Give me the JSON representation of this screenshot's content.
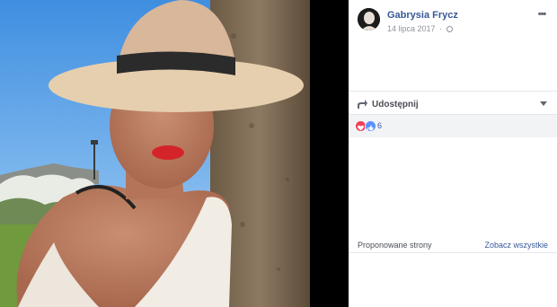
{
  "post": {
    "author": "Gabrysia Frycz",
    "date": "14 lipca 2017",
    "separator": "·",
    "more_label": "•••"
  },
  "actions": {
    "share_label": "Udostępnij"
  },
  "reactions": {
    "count": "6"
  },
  "suggested": {
    "title": "Proponowane strony",
    "see_all": "Zobacz wszystkie"
  },
  "colors": {
    "link": "#365899",
    "love": "#f33e58",
    "like": "#5890ff"
  },
  "icons": [
    "globe-icon",
    "share-icon",
    "love-icon",
    "like-icon",
    "chevron-down-icon",
    "more-icon"
  ]
}
